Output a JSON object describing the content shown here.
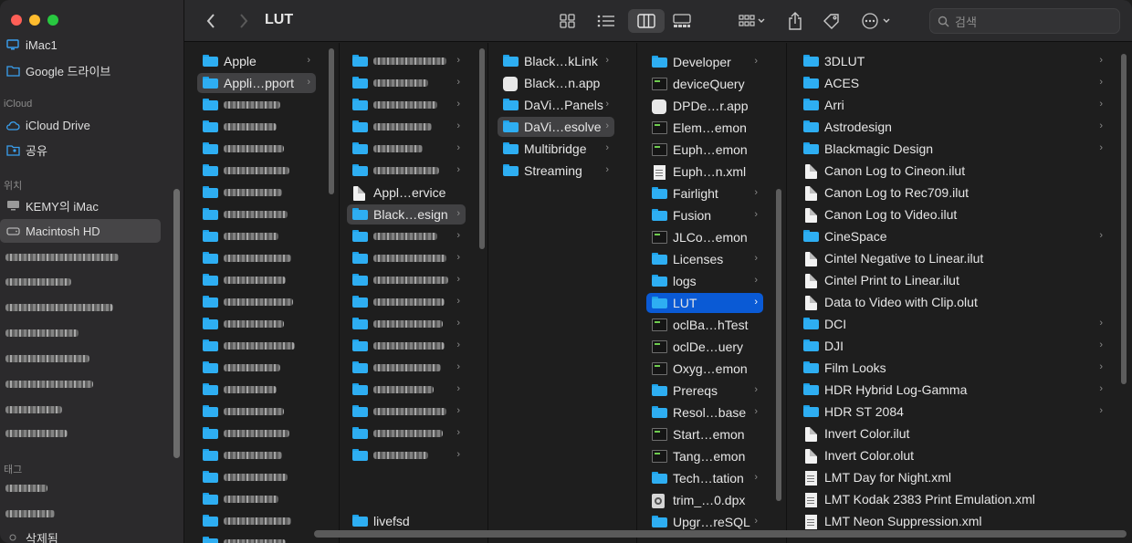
{
  "window": {
    "title": "LUT"
  },
  "toolbar": {
    "back_icon": "chevron-left-icon",
    "forward_icon": "chevron-right-icon",
    "views": [
      "icon-view-icon",
      "list-view-icon",
      "column-view-icon",
      "gallery-view-icon"
    ],
    "search_placeholder": "검색"
  },
  "sidebar": {
    "items": [
      {
        "label": "iMac1",
        "icon": "monitor-icon"
      },
      {
        "label": "Google 드라이브",
        "icon": "folder-icon"
      },
      {
        "section": "iCloud"
      },
      {
        "label": "iCloud Drive",
        "icon": "cloud-icon"
      },
      {
        "label": "공유",
        "icon": "shared-folder-icon"
      },
      {
        "section": "위치"
      },
      {
        "label": "KEMY의 iMac",
        "icon": "computer-icon"
      },
      {
        "label": "Macintosh HD",
        "icon": "disk-icon",
        "selected": true
      },
      {
        "section": "태그"
      },
      {
        "label": "삭제됨"
      }
    ]
  },
  "columns": {
    "col1": [
      "Apple",
      "Appli…pport"
    ],
    "col2": [
      "Appl…ervice",
      "Black…esign",
      "livefsd"
    ],
    "col3": [
      "Black…kLink",
      "Black…n.app",
      "DaVi…Panels",
      "DaVi…esolve",
      "Multibridge",
      "Streaming"
    ],
    "col4": [
      "Developer",
      "deviceQuery",
      "DPDe…r.app",
      "Elem…emon",
      "Euph…emon",
      "Euph…n.xml",
      "Fairlight",
      "Fusion",
      "JLCo…emon",
      "Licenses",
      "logs",
      "LUT",
      "oclBa…hTest",
      "oclDe…uery",
      "Oxyg…emon",
      "Prereqs",
      "Resol…base",
      "Start…emon",
      "Tang…emon",
      "Tech…tation",
      "trim_…0.dpx",
      "Upgr…reSQL"
    ],
    "col5": [
      "3DLUT",
      "ACES",
      "Arri",
      "Astrodesign",
      "Blackmagic Design",
      "Canon Log to Cineon.ilut",
      "Canon Log to Rec709.ilut",
      "Canon Log to Video.ilut",
      "CineSpace",
      "Cintel Negative to Linear.ilut",
      "Cintel Print to Linear.ilut",
      "Data to Video with Clip.olut",
      "DCI",
      "DJI",
      "Film Looks",
      "HDR Hybrid Log-Gamma",
      "HDR ST 2084",
      "Invert Color.ilut",
      "Invert Color.olut",
      "LMT Day for Night.xml",
      "LMT Kodak 2383 Print Emulation.xml",
      "LMT Neon Suppression.xml"
    ]
  },
  "colors": {
    "accent": "#0a5ad5",
    "folder": "#2eaef2"
  }
}
